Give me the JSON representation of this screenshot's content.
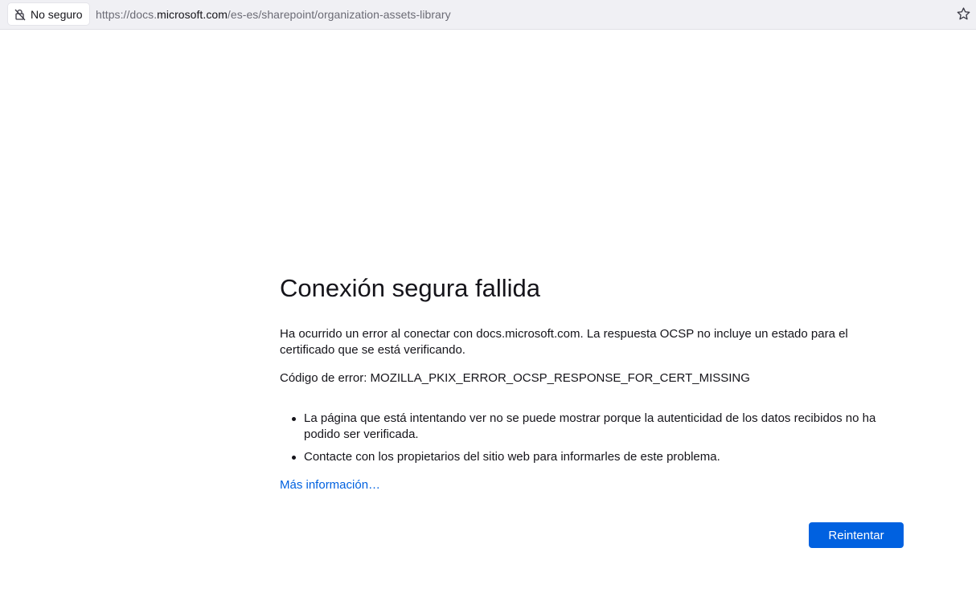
{
  "urlbar": {
    "identity_label": "No seguro",
    "url_prefix": "https://docs.",
    "url_host": "microsoft.com",
    "url_path": "/es-es/sharepoint/organization-assets-library"
  },
  "error": {
    "title": "Conexión segura fallida",
    "description": "Ha ocurrido un error al conectar con docs.microsoft.com. La respuesta OCSP no incluye un estado para el certificado que se está verificando.",
    "code_text": "Código de error: MOZILLA_PKIX_ERROR_OCSP_RESPONSE_FOR_CERT_MISSING",
    "bullets": [
      "La página que está intentando ver no se puede mostrar porque la autenticidad de los datos recibidos no ha podido ser verificada.",
      "Contacte con los propietarios del sitio web para informarles de este problema."
    ],
    "more_info_link": "Más información…",
    "retry_button": "Reintentar"
  },
  "colors": {
    "accent": "#0061e0",
    "urlbar_bg": "#f0f0f4",
    "text": "#15141a"
  },
  "icons": [
    "insecure-lock-icon",
    "bookmark-star-icon"
  ]
}
